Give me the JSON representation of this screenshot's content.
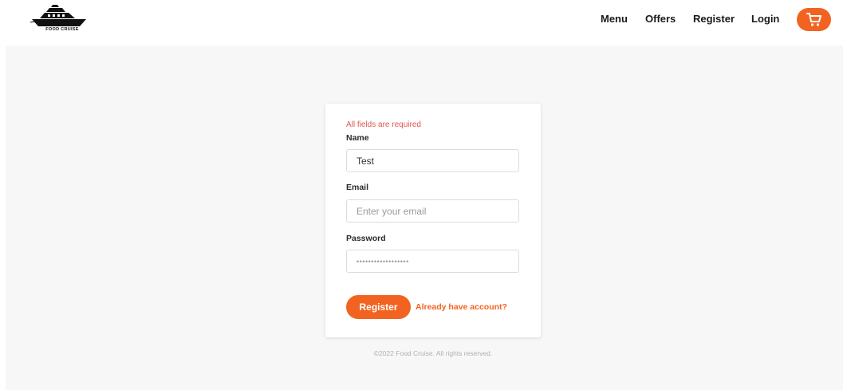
{
  "header": {
    "logo": {
      "icon": "cruise-ship-icon",
      "text": "FOOD CRUISE"
    },
    "nav": [
      {
        "label": "Menu"
      },
      {
        "label": "Offers"
      },
      {
        "label": "Register"
      },
      {
        "label": "Login"
      }
    ],
    "cart": {
      "icon": "cart-icon"
    }
  },
  "form": {
    "error": "All fields are required",
    "name": {
      "label": "Name",
      "value": "Test"
    },
    "email": {
      "label": "Email",
      "value": "",
      "placeholder": "Enter your email"
    },
    "password": {
      "label": "Password",
      "value": "••••••••••••••••••"
    },
    "submit_label": "Register",
    "login_link": "Already have account?"
  },
  "footer": {
    "text": "©2022 Food Cruise. All rights reserved."
  },
  "colors": {
    "accent": "#f26322",
    "error": "#e0584e",
    "page_background": "#f7f7f7"
  }
}
